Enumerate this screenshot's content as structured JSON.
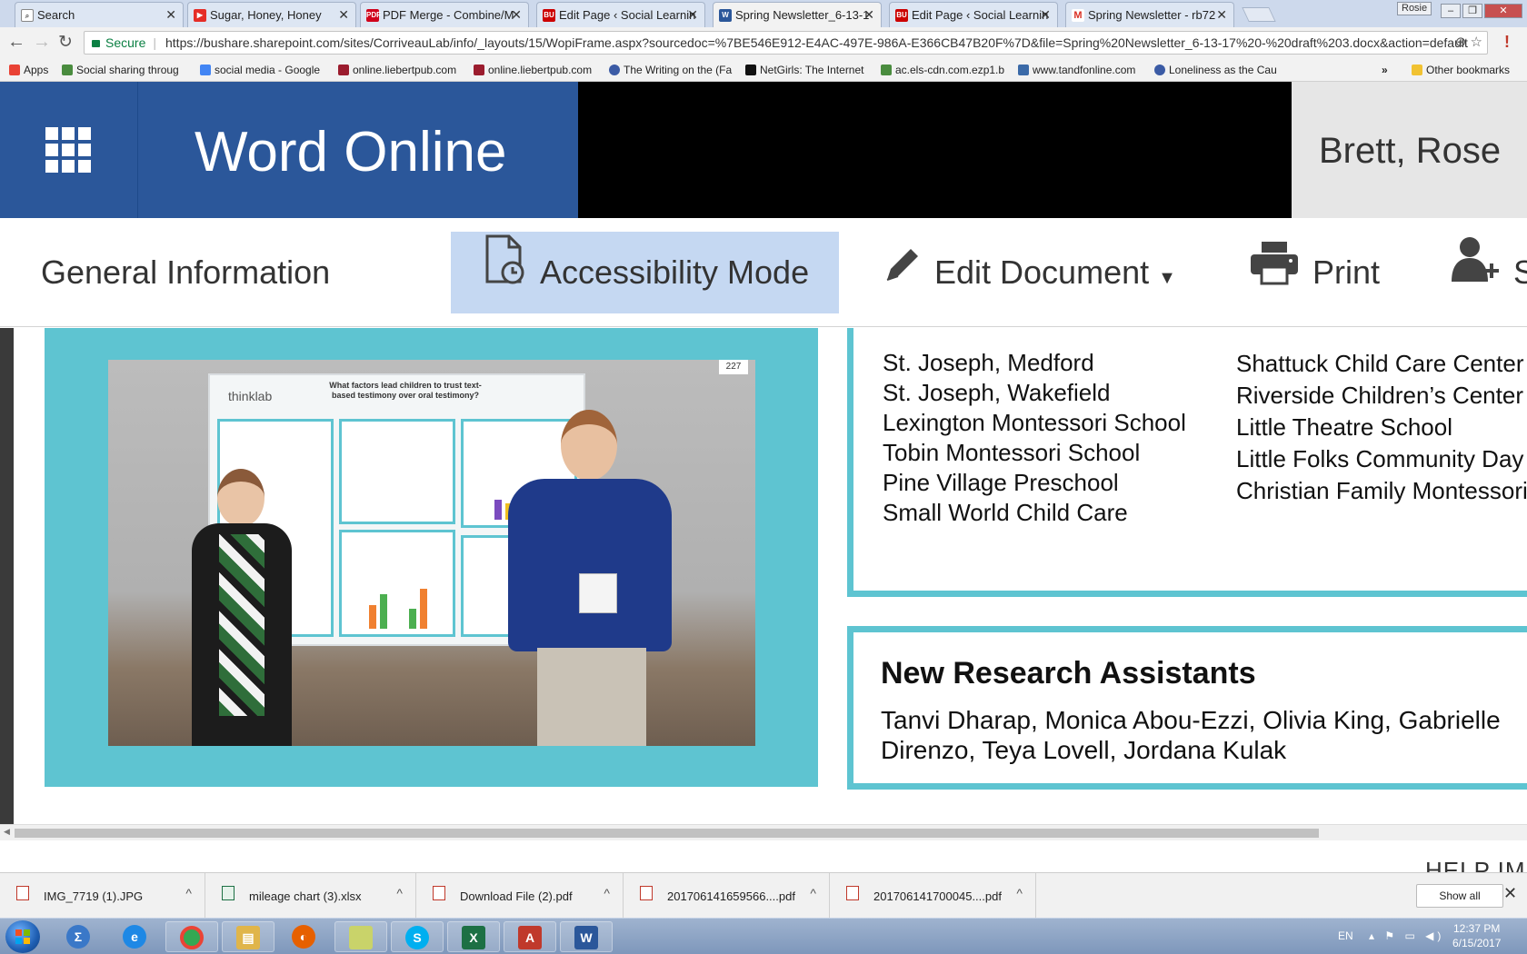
{
  "browser": {
    "tabs": [
      {
        "label": "Search",
        "icon": "search-icon",
        "color": "#5f6368"
      },
      {
        "label": "Sugar, Honey, Honey",
        "icon": "youtube-icon",
        "color": "#e52d27"
      },
      {
        "label": "PDF Merge - Combine/M",
        "icon": "pdf-icon",
        "color": "#d0021b"
      },
      {
        "label": "Edit Page ‹ Social Learnin",
        "icon": "bu-icon",
        "color": "#cc0000"
      },
      {
        "label": "Spring Newsletter_6-13-1",
        "icon": "word-icon",
        "color": "#2b579a"
      },
      {
        "label": "Edit Page ‹ Social Learnin",
        "icon": "bu-icon",
        "color": "#cc0000"
      },
      {
        "label": "Spring Newsletter - rb72",
        "icon": "gmail-icon",
        "color": "#d93025"
      }
    ],
    "profile_label": "Rosie",
    "secure_label": "Secure",
    "url": "https://bushare.sharepoint.com/sites/CorriveauLab/info/_layouts/15/WopiFrame.aspx?sourcedoc=%7BE546E912-E4AC-497E-986A-E366CB47B20F%7D&file=Spring%20Newsletter_6-13-17%20-%20draft%203.docx&action=default",
    "bookmarks": [
      {
        "label": "Apps",
        "icon": "apps-icon",
        "color": "#e94235"
      },
      {
        "label": "Social sharing throug",
        "icon": "sd-icon",
        "color": "#4a8c3f"
      },
      {
        "label": "social media - Google",
        "icon": "google-scholar-icon",
        "color": "#4285f4"
      },
      {
        "label": "online.liebertpub.com",
        "icon": "liebert-icon",
        "color": "#9b1c2e"
      },
      {
        "label": "online.liebertpub.com",
        "icon": "liebert-icon",
        "color": "#9b1c2e"
      },
      {
        "label": "The Writing on the (Fa",
        "icon": "ebsco-icon",
        "color": "#3b5ba5"
      },
      {
        "label": "NetGirls: The Internet",
        "icon": "w-icon",
        "color": "#111111"
      },
      {
        "label": "ac.els-cdn.com.ezp1.b",
        "icon": "sd-icon",
        "color": "#4a8c3f"
      },
      {
        "label": "www.tandfonline.com",
        "icon": "tandf-icon",
        "color": "#3b6aa8"
      },
      {
        "label": "Loneliness as the Cau",
        "icon": "ebsco-icon",
        "color": "#3b5ba5"
      }
    ],
    "overflow_label": "»",
    "other_bookmarks": "Other bookmarks"
  },
  "app": {
    "brand": "Word Online",
    "user": "Brett, Rose"
  },
  "ribbon": {
    "general_information": "General Information",
    "accessibility_mode": "Accessibility Mode",
    "edit_document": "Edit Document",
    "print": "Print",
    "share": "S",
    "active_color": "#c5d8f2"
  },
  "document": {
    "poster_title": "What factors lead children to trust text-based testimony over oral testimony?",
    "poster_logo": "thinklab",
    "poster_number": "227",
    "schools_col1": [
      "St. Joseph, Medford",
      "St. Joseph, Wakefield",
      "Lexington Montessori School",
      "Tobin Montessori School",
      "Pine Village Preschool",
      "Small World Child Care"
    ],
    "schools_col2": [
      "Shattuck Child Care Center",
      "Riverside Children’s Center",
      "Little Theatre School",
      "Little Folks Community Day",
      "Christian Family Montessori"
    ],
    "ra_title": "New Research Assistants",
    "ra_names": "Tanvi Dharap, Monica Abou-Ezzi, Olivia King, Gabrielle Direnzo, Teya Lovell, Jordana Kulak",
    "next_heading_peek": "HELP IM",
    "accent_color": "#5ec4d1"
  },
  "downloads": {
    "items": [
      {
        "name": "IMG_7719 (1).JPG",
        "icon": "image-file-icon"
      },
      {
        "name": "mileage chart (3).xlsx",
        "icon": "excel-file-icon"
      },
      {
        "name": "Download File (2).pdf",
        "icon": "pdf-file-icon"
      },
      {
        "name": "201706141659566....pdf",
        "icon": "pdf-file-icon"
      },
      {
        "name": "201706141700045....pdf",
        "icon": "pdf-file-icon"
      }
    ],
    "show_all": "Show all"
  },
  "taskbar": {
    "apps": [
      {
        "name": "internet-explorer-icon",
        "glyph": "e",
        "color": "#1e88e5"
      },
      {
        "name": "chrome-icon",
        "glyph": "◉",
        "color": "#34a853"
      },
      {
        "name": "file-explorer-icon",
        "glyph": "▤",
        "color": "#e0b54a"
      },
      {
        "name": "firefox-icon",
        "glyph": "◐",
        "color": "#e66000"
      },
      {
        "name": "sticky-notes-icon",
        "glyph": "▰",
        "color": "#c9d36a"
      },
      {
        "name": "skype-icon",
        "glyph": "S",
        "color": "#00aff0"
      },
      {
        "name": "excel-icon",
        "glyph": "X",
        "color": "#1d7044"
      },
      {
        "name": "acrobat-icon",
        "glyph": "A",
        "color": "#c0392b"
      },
      {
        "name": "word-icon",
        "glyph": "W",
        "color": "#2b579a"
      }
    ],
    "language": "EN",
    "time": "12:37 PM",
    "date": "6/15/2017"
  }
}
